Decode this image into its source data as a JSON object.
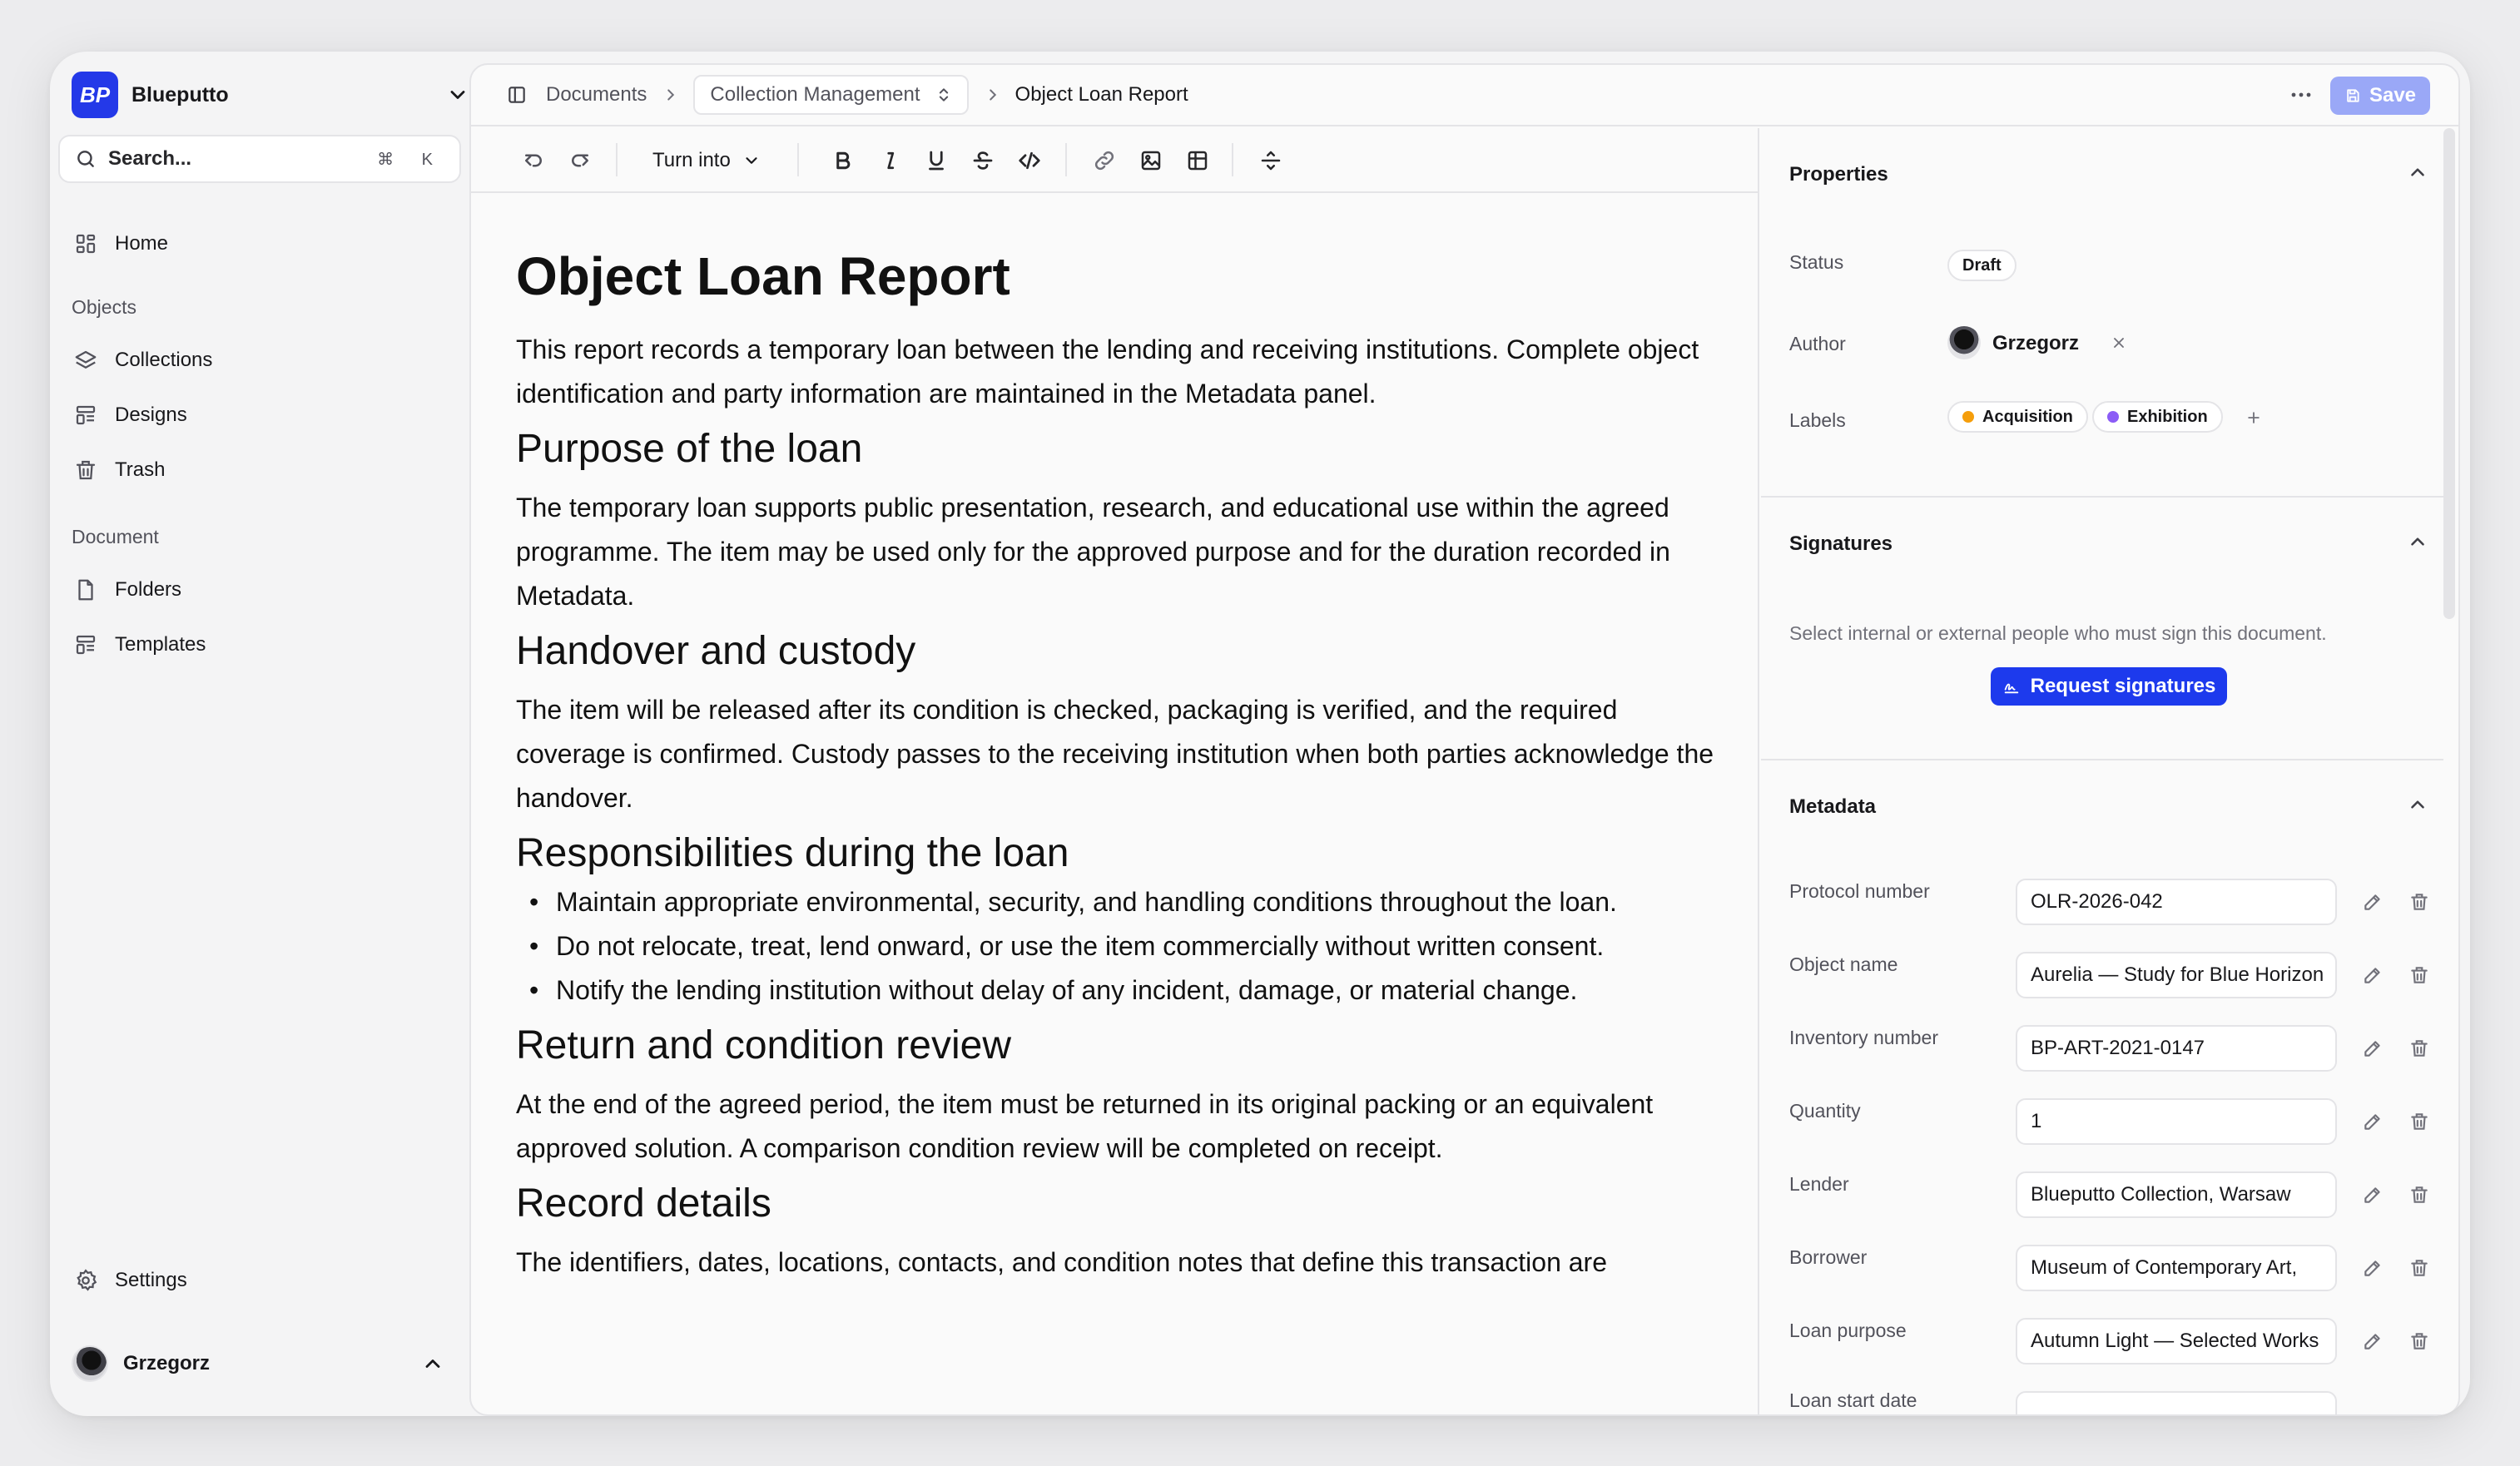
{
  "app": {
    "name": "Blueputto",
    "logo_text": "BP"
  },
  "sidebar": {
    "search_placeholder": "Search...",
    "search_shortcut": "⌘ K",
    "home": "Home",
    "objects_heading": "Objects",
    "objects": [
      "Collections",
      "Designs",
      "Trash"
    ],
    "document_heading": "Document",
    "document_items": [
      "Folders",
      "Templates"
    ],
    "settings": "Settings",
    "user_name": "Grzegorz"
  },
  "breadcrumb": {
    "root": "Documents",
    "collection": "Collection Management",
    "current": "Object Loan Report"
  },
  "header": {
    "save_label": "Save"
  },
  "toolbar": {
    "turn_into": "Turn into"
  },
  "document": {
    "title": "Object Loan Report",
    "intro": "This report records a temporary loan between the lending and receiving institutions. Complete object identification and party information are maintained in the Metadata panel.",
    "sections": [
      {
        "heading": "Purpose of the loan",
        "body": "The temporary loan supports public presentation, research, and educational use within the agreed programme. The item may be used only for the approved purpose and for the duration recorded in Metadata."
      },
      {
        "heading": "Handover and custody",
        "body": "The item will be released after its condition is checked, packaging is verified, and the required coverage is confirmed. Custody passes to the receiving institution when both parties acknowledge the handover."
      },
      {
        "heading": "Responsibilities during the loan",
        "bullets": [
          "Maintain appropriate environmental, security, and handling conditions throughout the loan.",
          "Do not relocate, treat, lend onward, or use the item commercially without written consent.",
          "Notify the lending institution without delay of any incident, damage, or material change."
        ]
      },
      {
        "heading": "Return and condition review",
        "body": "At the end of the agreed period, the item must be returned in its original packing or an equivalent approved solution. A comparison condition review will be completed on receipt."
      },
      {
        "heading": "Record details",
        "body": "The identifiers, dates, locations, contacts, and condition notes that define this transaction are"
      }
    ]
  },
  "properties": {
    "title": "Properties",
    "status_label": "Status",
    "status_value": "Draft",
    "author_label": "Author",
    "author_name": "Grzegorz",
    "labels_label": "Labels",
    "labels": [
      {
        "name": "Acquisition",
        "color": "#f59e0b"
      },
      {
        "name": "Exhibition",
        "color": "#8b5cf6"
      }
    ]
  },
  "signatures": {
    "title": "Signatures",
    "description": "Select internal or external people who must sign this document.",
    "button": "Request signatures"
  },
  "metadata": {
    "title": "Metadata",
    "fields": [
      {
        "label": "Protocol number",
        "value": "OLR-2026-042"
      },
      {
        "label": "Object name",
        "value": "Aurelia — Study for Blue Horizon"
      },
      {
        "label": "Inventory number",
        "value": "BP-ART-2021-0147"
      },
      {
        "label": "Quantity",
        "value": "1"
      },
      {
        "label": "Lender",
        "value": "Blueputto Collection, Warsaw"
      },
      {
        "label": "Borrower",
        "value": "Museum of Contemporary Art,"
      },
      {
        "label": "Loan purpose",
        "value": "Autumn Light — Selected Works"
      },
      {
        "label": "Loan start date",
        "value": ""
      }
    ]
  },
  "colors": {
    "accent": "#1d3aed",
    "save_disabled": "#9aa8f7"
  }
}
